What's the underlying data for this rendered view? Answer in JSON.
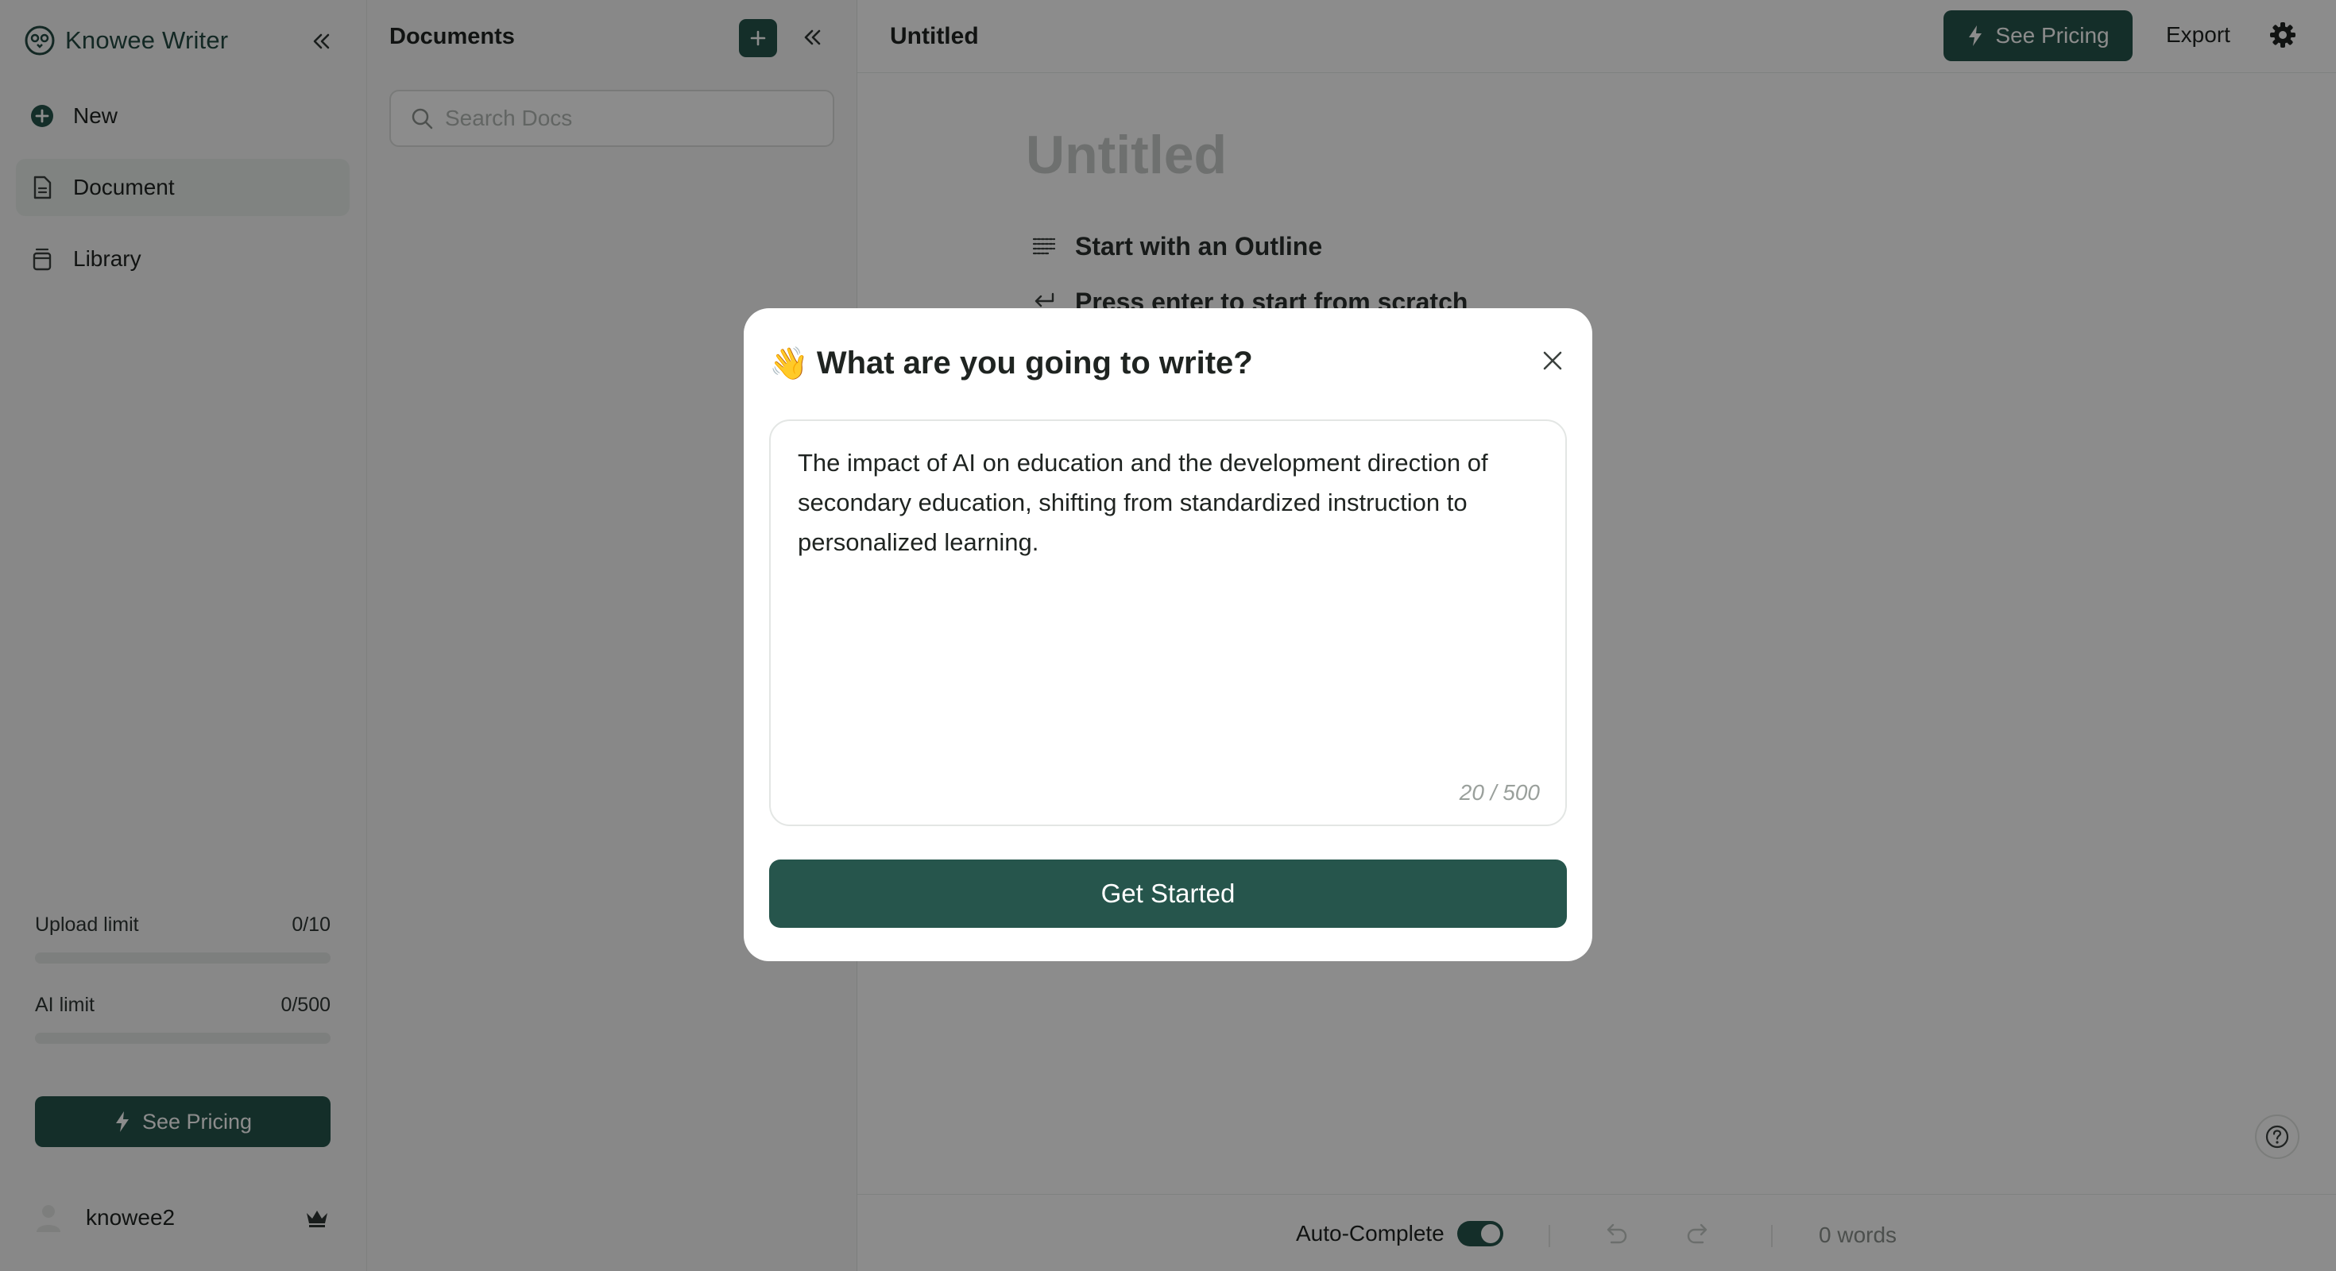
{
  "app": {
    "brand_name": "Knowee Writer"
  },
  "colors": {
    "accent": "#26554c",
    "overlay": "rgba(0,0,0,0.45)"
  },
  "sidebar": {
    "items": [
      {
        "label": "New",
        "icon": "plus-circle-icon"
      },
      {
        "label": "Document",
        "icon": "document-icon",
        "active": true
      },
      {
        "label": "Library",
        "icon": "library-icon"
      }
    ],
    "upload_limit": {
      "label": "Upload limit",
      "value": "0/10",
      "used_fraction": 0
    },
    "ai_limit": {
      "label": "AI limit",
      "value": "0/500",
      "used_fraction": 0
    },
    "pricing_label": "See Pricing",
    "username": "knowee2"
  },
  "docs_panel": {
    "title": "Documents",
    "search_placeholder": "Search Docs"
  },
  "editor": {
    "top_title": "Untitled",
    "pricing_label": "See Pricing",
    "export_label": "Export",
    "title_placeholder": "Untitled",
    "hint_outline": "Start with an Outline",
    "hint_scratch": "Press enter to start from scratch",
    "autocomplete_label": "Auto-Complete",
    "autocomplete_on": true,
    "word_count": "0 words"
  },
  "modal": {
    "emoji": "👋",
    "title": "What are you going to write?",
    "prompt_value": "The impact of AI on education and the development direction of secondary education, shifting from standardized instruction to personalized learning.",
    "counter": "20 / 500",
    "submit_label": "Get Started"
  }
}
